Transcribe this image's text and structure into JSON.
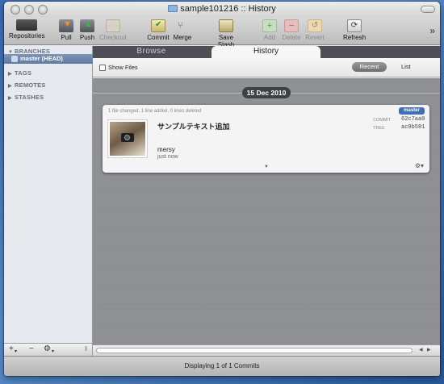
{
  "window": {
    "title": "sample101216 :: History"
  },
  "toolbar": {
    "repositories": "Repositories",
    "pull": "Pull",
    "push": "Push",
    "checkout": "Checkout",
    "commit": "Commit",
    "merge": "Merge",
    "save_stash": "Save Stash",
    "add": "Add",
    "delete": "Delete",
    "revert": "Revert",
    "refresh": "Refresh",
    "more": "»"
  },
  "sidebar": {
    "sections": {
      "branches": "BRANCHES",
      "tags": "TAGS",
      "remotes": "REMOTES",
      "stashes": "STASHES"
    },
    "selected_branch": "master (HEAD)",
    "bottom": {
      "add": "+",
      "remove": "−",
      "gear": "⚙"
    }
  },
  "tabs": {
    "browse": "Browse",
    "history": "History"
  },
  "filter": {
    "show_files_label": "Show Files",
    "recent": "Recent",
    "list": "List"
  },
  "history": {
    "date": "15 Dec 2010",
    "commit": {
      "stats": "1 file changed, 1 line added, 0 lines deleted",
      "branch": "master",
      "message": "サンプルテキスト追加",
      "author": "mersy",
      "time": "just now",
      "commit_label": "COMMIT",
      "commit_hash": "62c7aa0",
      "tree_label": "TREE",
      "tree_hash": "ac9b581"
    }
  },
  "status": {
    "text": "Displaying 1 of 1 Commits"
  },
  "colors": {
    "accent": "#3f6fb8",
    "selection": "#6d87ad",
    "content_bg": "#8e8f93"
  }
}
